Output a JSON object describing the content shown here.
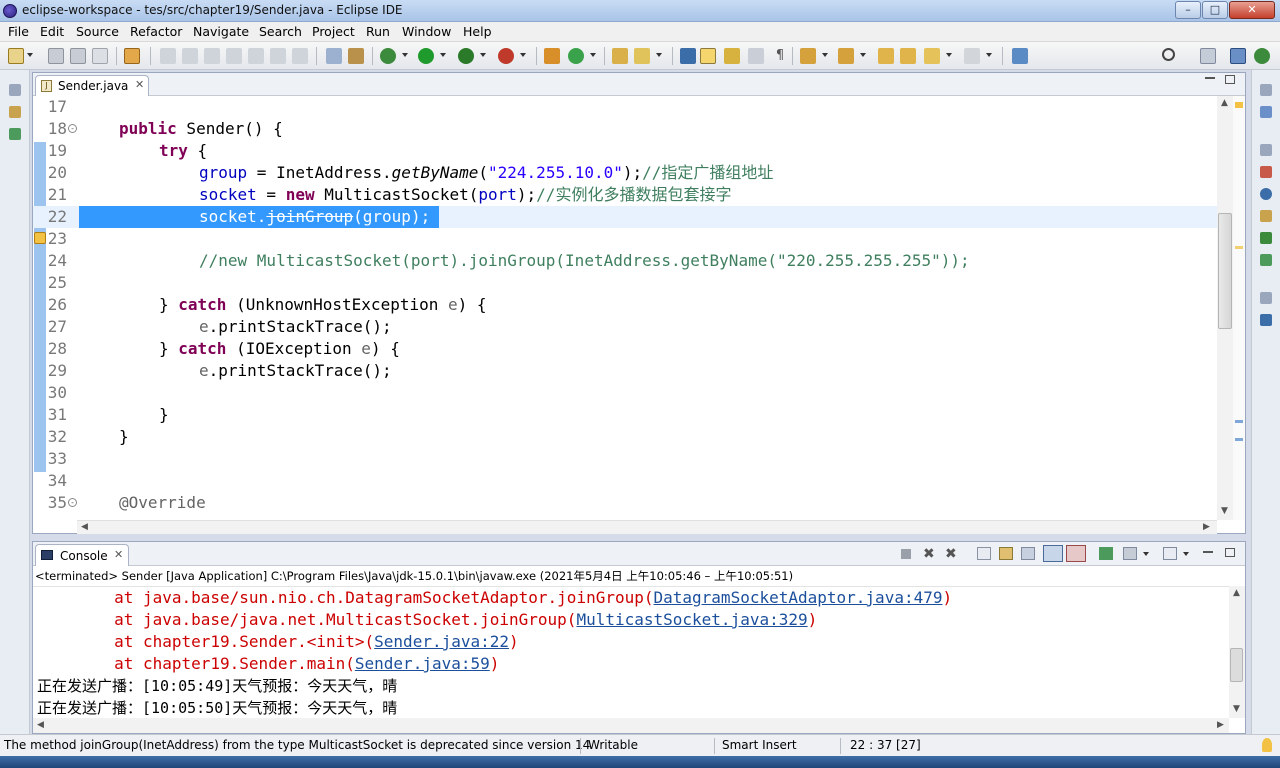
{
  "window": {
    "title": "eclipse-workspace - tes/src/chapter19/Sender.java - Eclipse IDE",
    "buttons": [
      "–",
      "□",
      "✕"
    ]
  },
  "menu": [
    "File",
    "Edit",
    "Source",
    "Refactor",
    "Navigate",
    "Search",
    "Project",
    "Run",
    "Window",
    "Help"
  ],
  "editor": {
    "tab": {
      "label": "Sender.java",
      "close": "✕",
      "icon": "java-file-icon"
    },
    "lines": [
      {
        "n": "17",
        "code": ""
      },
      {
        "n": "18",
        "code": ""
      },
      {
        "n": "19",
        "code": ""
      },
      {
        "n": "20",
        "code": ""
      },
      {
        "n": "21",
        "code": ""
      },
      {
        "n": "22",
        "code": ""
      },
      {
        "n": "23",
        "code": ""
      },
      {
        "n": "24",
        "code": ""
      },
      {
        "n": "25",
        "code": ""
      },
      {
        "n": "26",
        "code": ""
      },
      {
        "n": "27",
        "code": ""
      },
      {
        "n": "28",
        "code": ""
      },
      {
        "n": "29",
        "code": ""
      },
      {
        "n": "30",
        "code": ""
      },
      {
        "n": "31",
        "code": ""
      },
      {
        "n": "32",
        "code": ""
      },
      {
        "n": "33",
        "code": ""
      },
      {
        "n": "34",
        "code": ""
      },
      {
        "n": "35",
        "code": ""
      }
    ],
    "tokens": {
      "public": "public",
      "sender_ctor": " Sender() {",
      "try": "try",
      "try_brace": " {",
      "group": "group",
      "eq": " = InetAddress.",
      "getByName": "getByName",
      "str1": "\"224.255.10.0\"",
      "end1": ");",
      "cmt1": "//指定广播组地址",
      "socket": "socket",
      "eq2": " = ",
      "new": "new",
      "ms": " MulticastSocket(",
      "port": "port",
      "end2": ");",
      "cmt2": "//实例化多播数据包套接字",
      "sel_pre": "socket.",
      "sel_dep": "joinGroup",
      "sel_post": "(group);",
      "cmt3": "//new MulticastSocket(port).joinGroup(InetAddress.getByName(\"220.255.255.255\"));",
      "close_try": "} ",
      "catch": "catch",
      "catch1": " (UnknownHostException ",
      "e": "e",
      "catch_end": ") {",
      "e_print": "e",
      "print": ".printStackTrace();",
      "catch2": " (IOException ",
      "brace": "}",
      "override": "@Override"
    }
  },
  "console": {
    "tab": {
      "label": "Console",
      "close": "✕",
      "icon": "console-icon"
    },
    "description": "<terminated> Sender [Java Application] C:\\Program Files\\Java\\jdk-15.0.1\\bin\\javaw.exe  (2021年5月4日 上午10:05:46 – 上午10:05:51)",
    "lines": [
      {
        "pre": "        at java.base/sun.nio.ch.DatagramSocketAdaptor.joinGroup(",
        "link": "DatagramSocketAdaptor.java:479",
        "post": ")"
      },
      {
        "pre": "        at java.base/java.net.MulticastSocket.joinGroup(",
        "link": "MulticastSocket.java:329",
        "post": ")"
      },
      {
        "pre": "        at chapter19.Sender.<init>(",
        "link": "Sender.java:22",
        "post": ")"
      },
      {
        "pre": "        at chapter19.Sender.main(",
        "link": "Sender.java:59",
        "post": ")"
      }
    ],
    "output": [
      "正在发送广播：[10:05:49]天气预报：今天天气，晴",
      "正在发送广播：[10:05:50]天气预报：今天天气，晴"
    ]
  },
  "status": {
    "message": "The method joinGroup(InetAddress) from the type MulticastSocket is deprecated since version 14",
    "mode": "Writable",
    "insert": "Smart Insert",
    "position": "22 : 37 [27]"
  },
  "colors": {
    "keyword": "#7f0055",
    "field": "#0000c0",
    "string": "#2a00ff",
    "comment": "#3f7f5f",
    "error": "#cc0000",
    "link": "#1b4f9c",
    "selection": "#3399ff"
  }
}
